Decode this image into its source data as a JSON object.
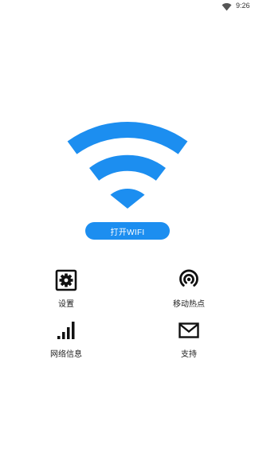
{
  "status_bar": {
    "time": "9:26",
    "wifi_icon": "wifi-icon",
    "battery_icon": "battery-icon"
  },
  "main": {
    "hero_icon": "wifi-icon",
    "accent_color": "#1c8ef0",
    "open_wifi_label": "打开WIFI"
  },
  "menu": {
    "settings": {
      "label": "设置",
      "icon": "gear-icon"
    },
    "hotspot": {
      "label": "移动热点",
      "icon": "hotspot-icon"
    },
    "network_info": {
      "label": "网络信息",
      "icon": "signal-bars-icon"
    },
    "support": {
      "label": "支持",
      "icon": "mail-icon"
    }
  }
}
